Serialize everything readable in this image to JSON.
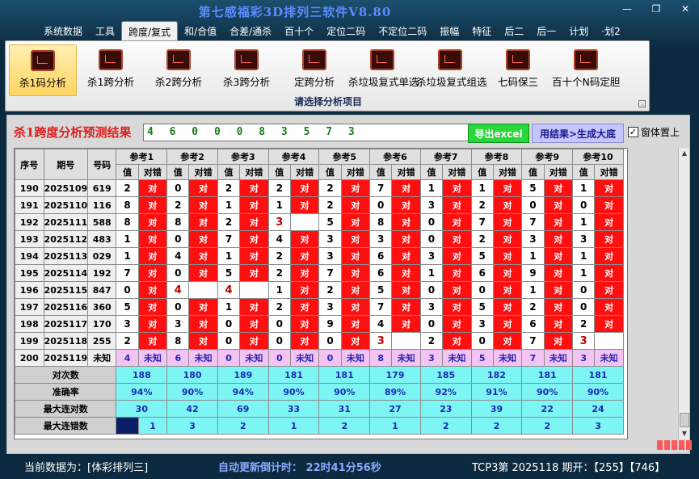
{
  "window": {
    "title": "第七感福彩3D排列三软件V8.80",
    "controls": [
      "—",
      "❐",
      "✕"
    ]
  },
  "menu": [
    {
      "label": "系统数据",
      "active": false
    },
    {
      "label": "工具",
      "active": false
    },
    {
      "label": "跨度/复式",
      "active": true
    },
    {
      "label": "和/合值",
      "active": false
    },
    {
      "label": "合差/通杀",
      "active": false
    },
    {
      "label": "百十个",
      "active": false
    },
    {
      "label": "定位二码",
      "active": false
    },
    {
      "label": "不定位二码",
      "active": false
    },
    {
      "label": "振幅",
      "active": false
    },
    {
      "label": "特征",
      "active": false
    },
    {
      "label": "后二",
      "active": false
    },
    {
      "label": "后一",
      "active": false
    },
    {
      "label": "计划",
      "active": false
    },
    {
      "label": "·划2",
      "active": false
    }
  ],
  "ribbon": {
    "tools": [
      {
        "label": "杀1码分析",
        "icon": "chart-analysis-icon",
        "selected": true
      },
      {
        "label": "杀1跨分析",
        "icon": "chart-analysis-icon",
        "selected": false
      },
      {
        "label": "杀2跨分析",
        "icon": "chart-analysis-icon",
        "selected": false
      },
      {
        "label": "杀3跨分析",
        "icon": "chart-analysis-icon",
        "selected": false
      },
      {
        "label": "定跨分析",
        "icon": "chart-analysis-icon",
        "selected": false
      },
      {
        "label": "杀垃圾复式单选",
        "icon": "chart-analysis-icon",
        "selected": false
      },
      {
        "label": "杀垃圾复式组选",
        "icon": "chart-analysis-icon",
        "selected": false
      },
      {
        "label": "七码保三",
        "icon": "chart-analysis-icon",
        "selected": false
      },
      {
        "label": "百十个N码定胆",
        "icon": "chart-analysis-icon",
        "selected": false
      }
    ],
    "group_label": "请选择分析项目"
  },
  "result": {
    "title": "杀1跨度分析预测结果",
    "value": "4 6 0 0 0 8 3 5 7 3",
    "export_label": "导出excel",
    "bottom_label": "用结果>生成大底",
    "pin_label": "窗体置上",
    "pin_checked": true
  },
  "table": {
    "head": {
      "seq": "序号",
      "period": "期号",
      "number": "号码",
      "value": "值",
      "check": "对错"
    },
    "refs": [
      "参考1",
      "参考2",
      "参考3",
      "参考4",
      "参考5",
      "参考6",
      "参考7",
      "参考8",
      "参考9",
      "参考10"
    ],
    "ok_text": "对",
    "rows": [
      {
        "seq": "190",
        "period": "2025109",
        "number": "619",
        "vals": [
          "2",
          "0",
          "2",
          "2",
          "2",
          "7",
          "1",
          "1",
          "5",
          "1"
        ],
        "hits": [
          false,
          false,
          false,
          false,
          false,
          false,
          false,
          false,
          false,
          false
        ]
      },
      {
        "seq": "191",
        "period": "2025110",
        "number": "116",
        "vals": [
          "8",
          "2",
          "1",
          "1",
          "2",
          "0",
          "3",
          "2",
          "0",
          "0"
        ],
        "hits": [
          false,
          false,
          false,
          false,
          false,
          false,
          false,
          false,
          false,
          false
        ]
      },
      {
        "seq": "192",
        "period": "2025111",
        "number": "588",
        "vals": [
          "8",
          "8",
          "2",
          "3",
          "5",
          "8",
          "0",
          "7",
          "7",
          "1"
        ],
        "hits": [
          false,
          false,
          false,
          true,
          false,
          false,
          false,
          false,
          false,
          false
        ]
      },
      {
        "seq": "193",
        "period": "2025112",
        "number": "483",
        "vals": [
          "1",
          "0",
          "7",
          "4",
          "3",
          "3",
          "0",
          "2",
          "3",
          "3"
        ],
        "hits": [
          false,
          false,
          false,
          false,
          false,
          false,
          false,
          false,
          false,
          false
        ]
      },
      {
        "seq": "194",
        "period": "2025113",
        "number": "029",
        "vals": [
          "1",
          "4",
          "1",
          "2",
          "3",
          "6",
          "3",
          "5",
          "1",
          "1"
        ],
        "hits": [
          false,
          false,
          false,
          false,
          false,
          false,
          false,
          false,
          false,
          false
        ]
      },
      {
        "seq": "195",
        "period": "2025114",
        "number": "192",
        "vals": [
          "7",
          "0",
          "5",
          "2",
          "7",
          "6",
          "1",
          "6",
          "9",
          "1"
        ],
        "hits": [
          false,
          false,
          false,
          false,
          false,
          false,
          false,
          false,
          false,
          false
        ]
      },
      {
        "seq": "196",
        "period": "2025115",
        "number": "847",
        "vals": [
          "0",
          "4",
          "4",
          "1",
          "2",
          "5",
          "0",
          "0",
          "1",
          "0"
        ],
        "hits": [
          false,
          true,
          true,
          false,
          false,
          false,
          false,
          false,
          false,
          false
        ]
      },
      {
        "seq": "197",
        "period": "2025116",
        "number": "360",
        "vals": [
          "5",
          "0",
          "1",
          "2",
          "3",
          "7",
          "3",
          "5",
          "2",
          "0"
        ],
        "hits": [
          false,
          false,
          false,
          false,
          false,
          false,
          false,
          false,
          false,
          false
        ]
      },
      {
        "seq": "198",
        "period": "2025117",
        "number": "170",
        "vals": [
          "3",
          "3",
          "0",
          "0",
          "9",
          "4",
          "0",
          "3",
          "6",
          "2"
        ],
        "hits": [
          false,
          false,
          false,
          false,
          false,
          false,
          false,
          false,
          false,
          false
        ]
      },
      {
        "seq": "199",
        "period": "2025118",
        "number": "255",
        "vals": [
          "2",
          "8",
          "0",
          "0",
          "0",
          "3",
          "2",
          "0",
          "7",
          "3"
        ],
        "hits": [
          false,
          false,
          false,
          false,
          false,
          true,
          false,
          false,
          false,
          true
        ]
      }
    ],
    "future": {
      "seq": "200",
      "period": "2025119",
      "number": "未知",
      "vals": [
        "4",
        "6",
        "0",
        "0",
        "0",
        "8",
        "3",
        "5",
        "7",
        "3"
      ],
      "unknown": "未知"
    },
    "stats": [
      {
        "label": "对次数",
        "values": [
          "188",
          "180",
          "189",
          "181",
          "181",
          "179",
          "185",
          "182",
          "181",
          "181"
        ]
      },
      {
        "label": "准确率",
        "values": [
          "94%",
          "90%",
          "94%",
          "90%",
          "90%",
          "89%",
          "92%",
          "91%",
          "90%",
          "90%"
        ]
      },
      {
        "label": "最大连对数",
        "values": [
          "30",
          "42",
          "69",
          "33",
          "31",
          "27",
          "23",
          "39",
          "22",
          "24"
        ]
      },
      {
        "label": "最大连错数",
        "values": [
          "1",
          "3",
          "2",
          "1",
          "2",
          "1",
          "2",
          "2",
          "2",
          "3"
        ]
      }
    ]
  },
  "statusbar": {
    "current_data": "当前数据为：[体彩排列三]",
    "countdown": "自动更新倒计时： 22时41分56秒",
    "last_draw": "TCP3第 2025118 期开：【255】【746】"
  }
}
